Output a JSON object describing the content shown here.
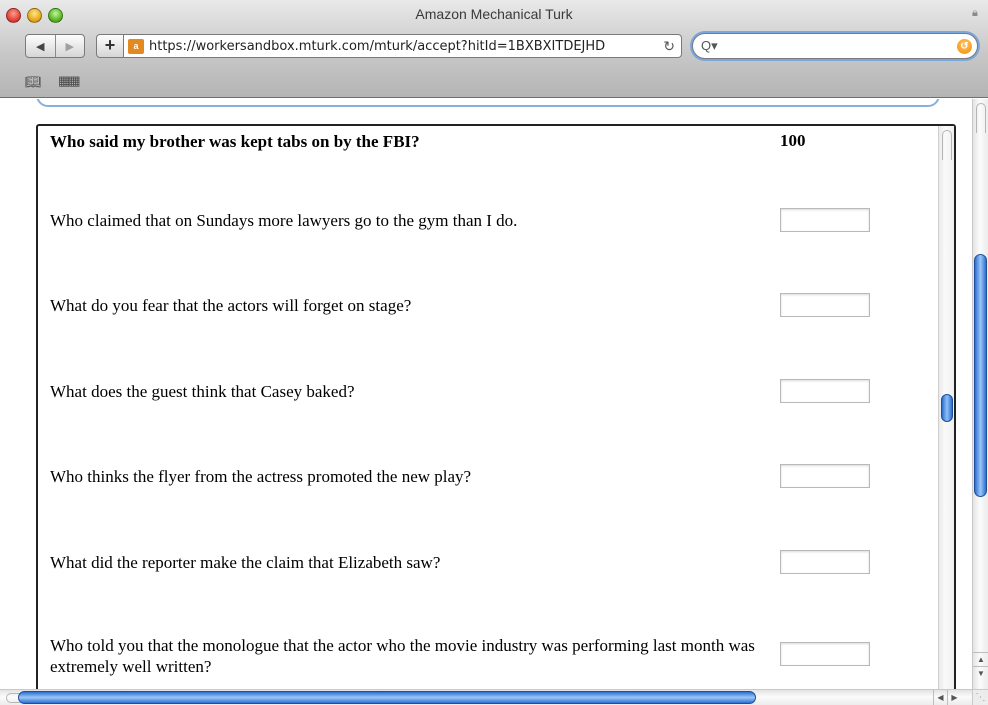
{
  "window": {
    "title": "Amazon Mechanical Turk"
  },
  "toolbar": {
    "url": "https://workersandbox.mturk.com/mturk/accept?hitId=1BXBXITDEJHD",
    "icons": [
      "back-arrow-icon",
      "forward-arrow-icon",
      "add-bookmark-icon",
      "amazon-favicon",
      "reload-icon",
      "search-icon",
      "snapback-icon",
      "bookmarks-icon",
      "top-sites-icon",
      "lock-icon"
    ]
  },
  "survey": {
    "header_question": "Who said my brother was kept tabs on by the FBI?",
    "header_score": "100",
    "questions": [
      {
        "text": "Who claimed that on Sundays more lawyers go to the gym than I do.",
        "answer": ""
      },
      {
        "text": "What do you fear that the actors will forget on stage?",
        "answer": ""
      },
      {
        "text": "What does the guest think that Casey baked?",
        "answer": ""
      },
      {
        "text": "Who thinks the flyer from the actress promoted the new play?",
        "answer": ""
      },
      {
        "text": "What did the reporter make the claim that Elizabeth saw?",
        "answer": ""
      },
      {
        "text": "Who told you that the monologue that the actor who the movie industry was performing last month was extremely well written?",
        "answer": ""
      }
    ]
  },
  "colors": {
    "scroll_thumb": "#2c6fd1",
    "search_focus": "#79a8e0",
    "search_go": "#f08e0a"
  }
}
